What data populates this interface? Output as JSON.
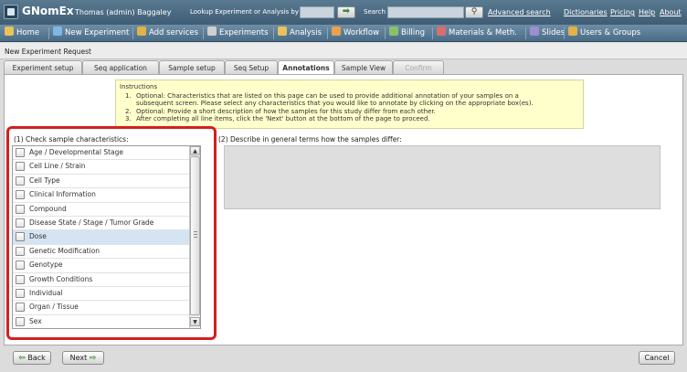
{
  "header": {
    "app_title": "GNomEx",
    "user": "Thomas (admin) Baggaley",
    "lookup_label": "Lookup Experiment or Analysis by #",
    "go_icon": "arrow-right-icon",
    "search_label": "Search",
    "search_icon": "magnifier-icon",
    "advanced_search": "Advanced search",
    "links": [
      "Dictionaries",
      "Pricing",
      "Help",
      "About"
    ]
  },
  "nav": {
    "items": [
      {
        "label": "Home",
        "icon": "home-icon",
        "color": "#e8c25a"
      },
      {
        "label": "New Experiment",
        "icon": "flask-icon",
        "color": "#7fb7e0"
      },
      {
        "label": "Add services",
        "icon": "services-icon",
        "color": "#e0b24a"
      },
      {
        "label": "Experiments",
        "icon": "flask-icon",
        "color": "#cfcfcf"
      },
      {
        "label": "Analysis",
        "icon": "chart-icon",
        "color": "#e9c15e"
      },
      {
        "label": "Workflow",
        "icon": "workflow-icon",
        "color": "#e8a24d"
      },
      {
        "label": "Billing",
        "icon": "billing-icon",
        "color": "#8cc06a"
      },
      {
        "label": "Materials & Meth.",
        "icon": "materials-icon",
        "color": "#d86f6f"
      },
      {
        "label": "Slides",
        "icon": "slides-icon",
        "color": "#9c8fd0"
      },
      {
        "label": "Users & Groups",
        "icon": "users-icon",
        "color": "#e0b24a"
      }
    ]
  },
  "panel": {
    "title": "New Experiment Request",
    "tabs": [
      {
        "label": "Experiment setup",
        "state": "normal"
      },
      {
        "label": "Seq application",
        "state": "normal"
      },
      {
        "label": "Sample setup",
        "state": "normal"
      },
      {
        "label": "Seq Setup",
        "state": "normal"
      },
      {
        "label": "Annotations",
        "state": "active"
      },
      {
        "label": "Sample View",
        "state": "normal"
      },
      {
        "label": "Confirm",
        "state": "disabled"
      }
    ]
  },
  "instructions": {
    "title": "Instructions",
    "lines": [
      {
        "num": "1.",
        "text": "Optional: Characteristics that are listed on this page can be used to provide additional annotation of your samples on a"
      },
      {
        "num": "",
        "text": "subsequent screen. Please select any characteristics that you would like to annotate by clicking on the appropriate box(es)."
      },
      {
        "num": "2.",
        "text": "Optional: Provide a short description of how the samples for this study differ from each other."
      },
      {
        "num": "3.",
        "text": "After completing all line items, click the 'Next' button at the bottom of the page to proceed."
      }
    ]
  },
  "characteristics": {
    "label": "(1) Check sample characteristics:",
    "items": [
      "Age / Developmental Stage",
      "Cell Line / Strain",
      "Cell Type",
      "Clinical Information",
      "Compound",
      "Disease State / Stage / Tumor Grade",
      "Dose",
      "Genetic Modification",
      "Genotype",
      "Growth Conditions",
      "Individual",
      "Organ / Tissue",
      "Sex"
    ],
    "selected_index": 6
  },
  "description": {
    "label": "(2) Describe in general terms how the samples differ:",
    "value": ""
  },
  "footer": {
    "back": "Back",
    "next": "Next",
    "cancel": "Cancel"
  }
}
